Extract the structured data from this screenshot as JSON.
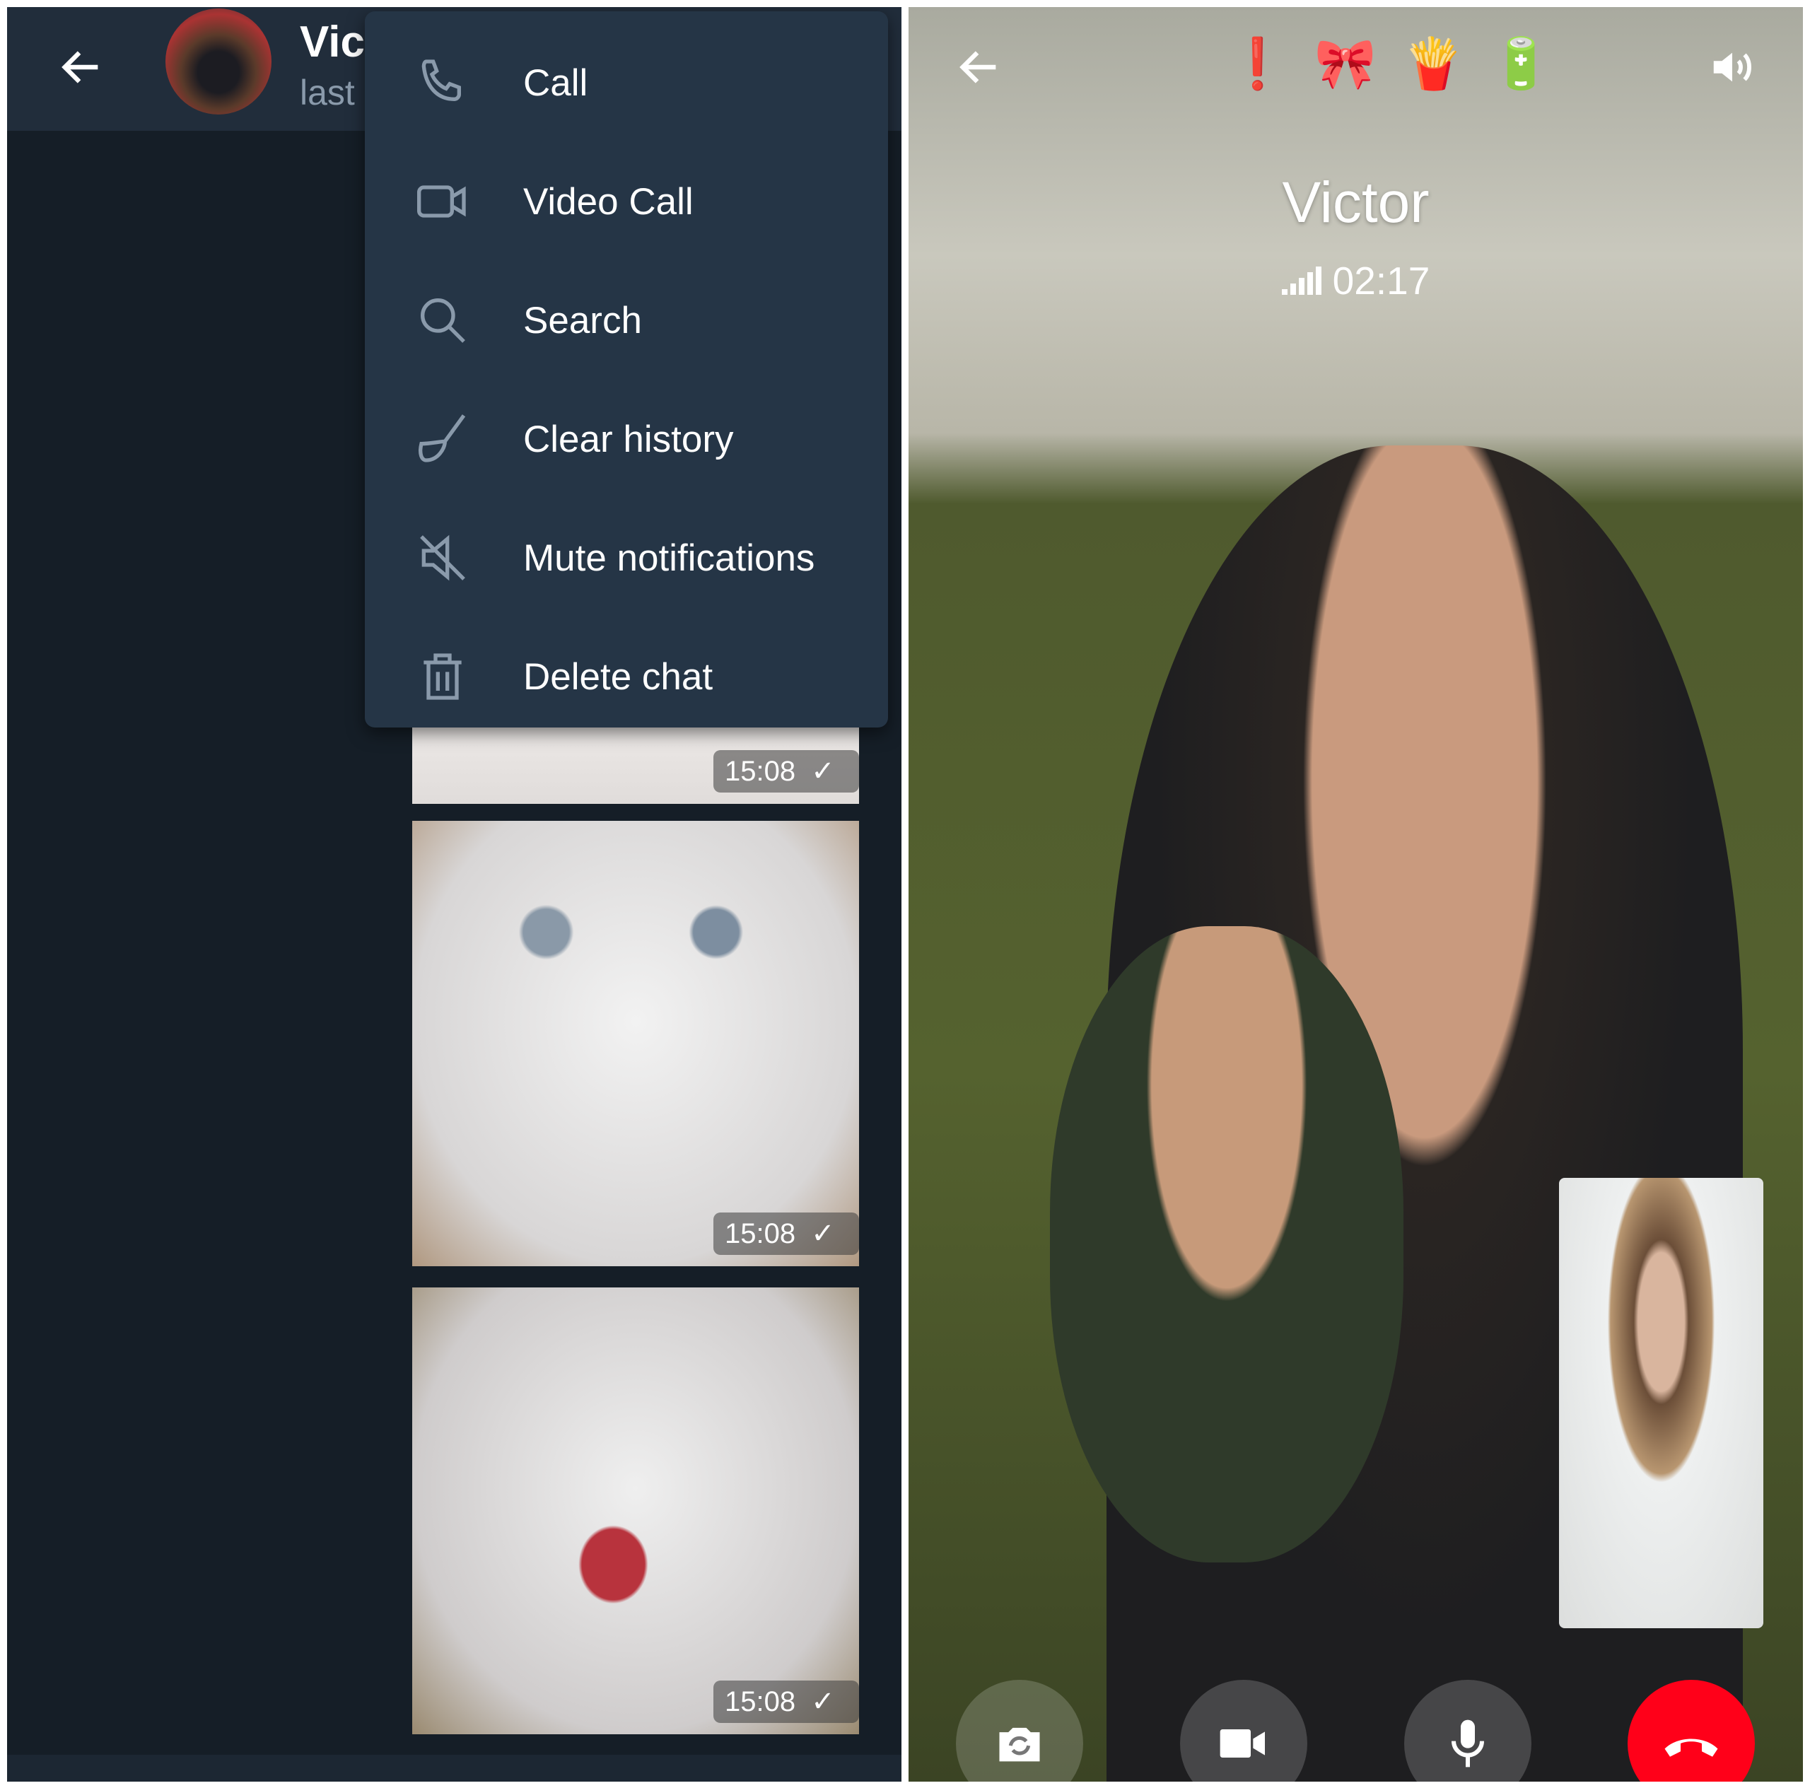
{
  "chat": {
    "contact_name_truncated": "Vic",
    "status_truncated": "last",
    "menu": [
      {
        "icon": "phone-icon",
        "label": "Call"
      },
      {
        "icon": "video-camera-icon",
        "label": "Video Call"
      },
      {
        "icon": "search-icon",
        "label": "Search"
      },
      {
        "icon": "broom-icon",
        "label": "Clear history"
      },
      {
        "icon": "mute-icon",
        "label": "Mute notifications"
      },
      {
        "icon": "trash-icon",
        "label": "Delete chat"
      }
    ],
    "messages": [
      {
        "time": "15:08"
      },
      {
        "time": "15:08"
      },
      {
        "time": "15:08"
      }
    ]
  },
  "call": {
    "name": "Victor",
    "duration": "02:17",
    "emojis": [
      "❗",
      "🎀",
      "🍟",
      "🔋"
    ],
    "end_call_color": "#ff0019"
  },
  "colors": {
    "header": "#212d3b",
    "menu": "#253546",
    "background": "#151e27"
  }
}
